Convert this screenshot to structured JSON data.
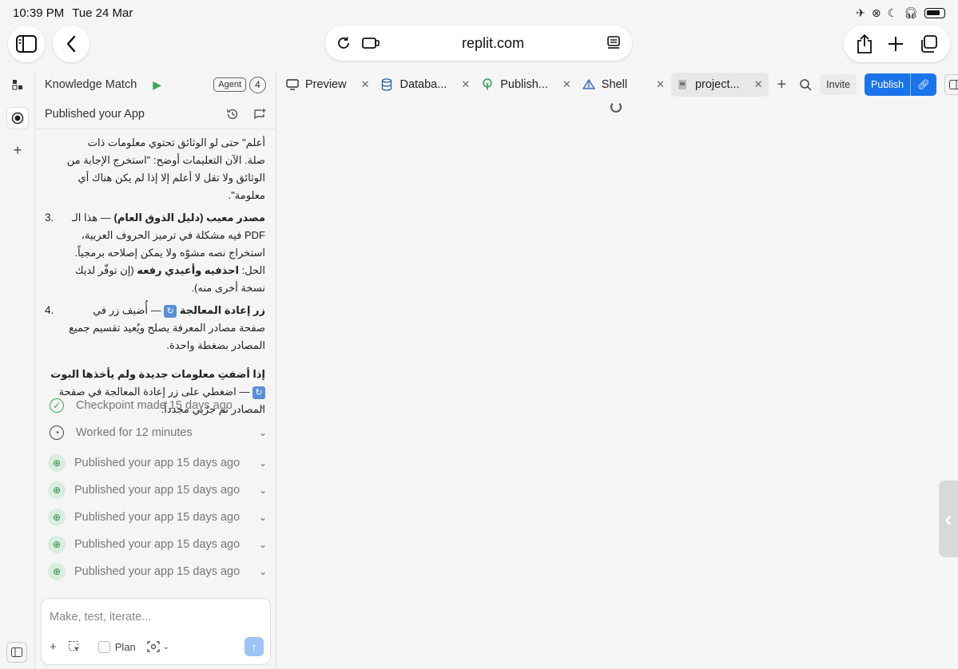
{
  "status": {
    "time": "10:39 PM",
    "date": "Tue 24 Mar"
  },
  "browser": {
    "url": "replit.com"
  },
  "chat": {
    "project_name": "Knowledge Match",
    "agent_label": "Agent",
    "agent_count": "4",
    "subtitle": "Published your App",
    "message": {
      "line_top": "أعلم\" حتى لو الوثائق تحتوي معلومات ذات صلة. الآن التعليمات أوضح: \"استخرج الإجابة من الوثائق ولا تقل لا أعلم إلا إذا لم يكن هناك أي معلومة\".",
      "item3_num": "3.",
      "item3_bold": "مصدر معيب (دليل الذوق العام)",
      "item3_rest": "— هذا الـ PDF فيه مشكلة في ترميز الحروف العربية، استخراج نصه مشوّه ولا يمكن إصلاحه برمجياً. الحل:",
      "item3_bold2": "احذفيه وأعيدي رفعه",
      "item3_tail": "(إن توفّر لديك نسخة أخرى منه).",
      "item4_num": "4.",
      "item4_bold": "زر إعادة المعالجة",
      "item4_rest": "— أُضيف زر في صفحة مصادر المعرفة يصلح ويُعيد تقسيم جميع المصادر بضغطة واحدة.",
      "para_bold": "إذا أضفتِ معلومات جديدة ولم يأخذها البوت",
      "para_rest": "— اضغطي على زر إعادة المعالجة في صفحة المصادر ثم جرّبي مجدداً."
    },
    "events": [
      {
        "type": "check",
        "label": "Checkpoint made 15 days ago"
      },
      {
        "type": "clock",
        "label": "Worked for 12 minutes"
      },
      {
        "type": "pub",
        "label": "Published your app 15 days ago"
      },
      {
        "type": "pub",
        "label": "Published your app 15 days ago"
      },
      {
        "type": "pub",
        "label": "Published your app 15 days ago"
      },
      {
        "type": "pub",
        "label": "Published your app 15 days ago"
      },
      {
        "type": "pub",
        "label": "Published your app 15 days ago"
      }
    ],
    "composer": {
      "placeholder": "Make, test, iterate...",
      "plan_label": "Plan"
    }
  },
  "tabs": [
    {
      "label": "Preview",
      "icon": "monitor-icon"
    },
    {
      "label": "Databa...",
      "icon": "database-icon"
    },
    {
      "label": "Publish...",
      "icon": "publish-icon"
    },
    {
      "label": "Shell",
      "icon": "shell-icon"
    },
    {
      "label": "project...",
      "icon": "file-icon"
    }
  ],
  "toolbar": {
    "invite": "Invite",
    "publish": "Publish"
  },
  "colors": {
    "accent": "#1a73e8",
    "green": "#3aa658"
  }
}
